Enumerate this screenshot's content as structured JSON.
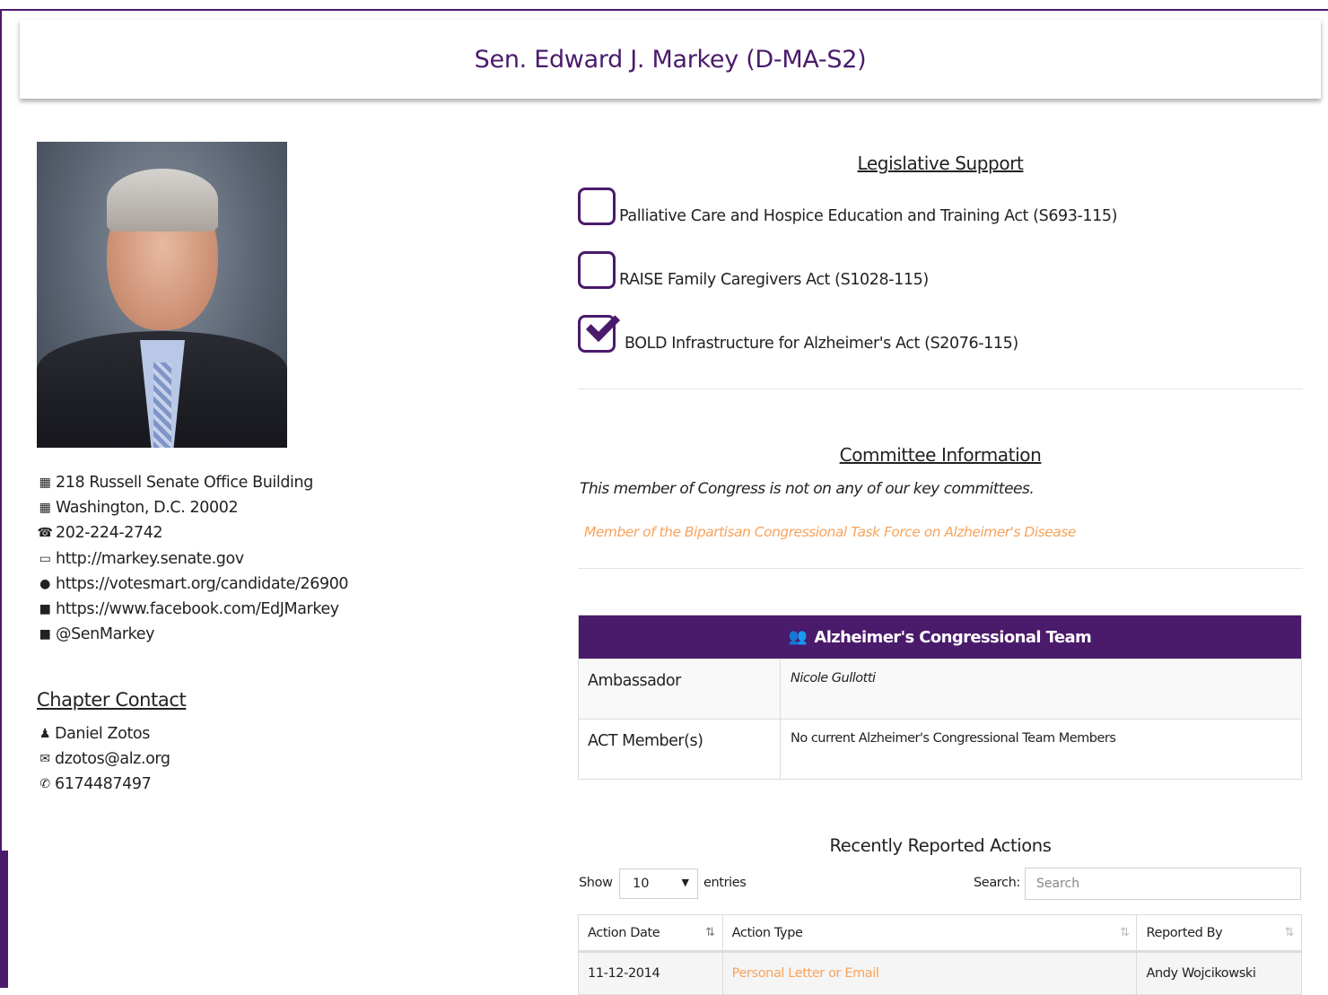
{
  "header": {
    "title": "Sen. Edward J. Markey (D-MA-S2)"
  },
  "contact": {
    "address_line1": "218 Russell Senate Office Building",
    "address_line2": "Washington, D.C. 20002",
    "phone": "202-224-2742",
    "website": "http://markey.senate.gov",
    "votesmart": "https://votesmart.org/candidate/26900",
    "facebook": "https://www.facebook.com/EdJMarkey",
    "twitter": "@SenMarkey"
  },
  "chapter_contact": {
    "title": "Chapter Contact",
    "name": "Daniel Zotos",
    "email": "dzotos@alz.org",
    "phone": "6174487497"
  },
  "legislative_support": {
    "title": "Legislative Support",
    "bills": [
      {
        "label": "Palliative Care and Hospice Education and Training Act (S693-115)",
        "checked": false
      },
      {
        "label": "RAISE Family Caregivers Act (S1028-115)",
        "checked": false
      },
      {
        "label": "BOLD Infrastructure for Alzheimer's Act (S2076-115)",
        "checked": true
      }
    ]
  },
  "committee": {
    "title": "Committee Information",
    "note": "This member of Congress is not on any of our key committees.",
    "task_force": "Member of the Bipartisan Congressional Task Force on Alzheimer's Disease"
  },
  "team": {
    "title": "Alzheimer's Congressional Team",
    "rows": [
      {
        "label": "Ambassador",
        "value": "Nicole Gullotti"
      },
      {
        "label": "ACT Member(s)",
        "value": "No current Alzheimer's Congressional Team Members"
      }
    ]
  },
  "actions": {
    "title": "Recently Reported Actions",
    "show_label": "Show",
    "page_size": "10",
    "entries_label": "entries",
    "search_label": "Search:",
    "search_placeholder": "Search",
    "columns": [
      "Action Date",
      "Action Type",
      "Reported By"
    ],
    "rows": [
      {
        "date": "11-12-2014",
        "type": "Personal Letter or Email",
        "reported_by": "Andy Wojcikowski"
      }
    ]
  },
  "colors": {
    "brand": "#4a1a6b",
    "accent": "#f7a35c"
  }
}
